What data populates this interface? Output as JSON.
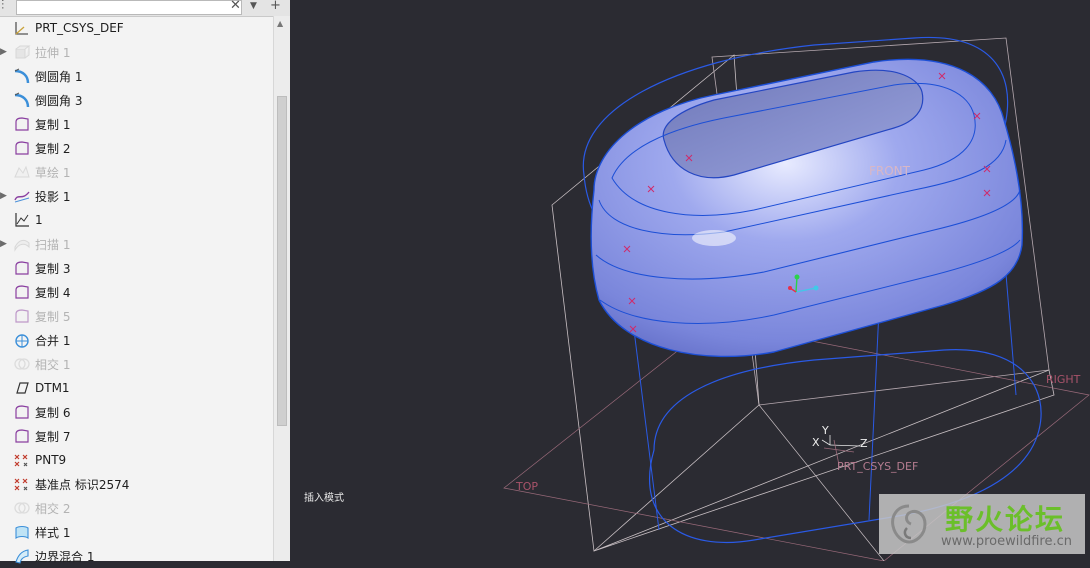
{
  "tree": {
    "items": [
      {
        "label": "PRT_CSYS_DEF",
        "icon": "csys-icon",
        "suppressed": false,
        "expandable": false
      },
      {
        "label": "拉伸 1",
        "icon": "extrude-icon",
        "suppressed": true,
        "expandable": true
      },
      {
        "label": "倒圆角 1",
        "icon": "round-icon",
        "suppressed": false,
        "expandable": false
      },
      {
        "label": "倒圆角 3",
        "icon": "round-icon",
        "suppressed": false,
        "expandable": false
      },
      {
        "label": "复制 1",
        "icon": "copy-surface-icon",
        "suppressed": false,
        "expandable": false
      },
      {
        "label": "复制 2",
        "icon": "copy-surface-icon",
        "suppressed": false,
        "expandable": false
      },
      {
        "label": "草绘 1",
        "icon": "sketch-icon",
        "suppressed": true,
        "expandable": false
      },
      {
        "label": "投影 1",
        "icon": "project-icon",
        "suppressed": false,
        "expandable": true
      },
      {
        "label": "1",
        "icon": "graph-icon",
        "suppressed": false,
        "expandable": false
      },
      {
        "label": "扫描 1",
        "icon": "sweep-icon",
        "suppressed": true,
        "expandable": true
      },
      {
        "label": "复制 3",
        "icon": "copy-surface-icon",
        "suppressed": false,
        "expandable": false
      },
      {
        "label": "复制 4",
        "icon": "copy-surface-icon",
        "suppressed": false,
        "expandable": false
      },
      {
        "label": "复制 5",
        "icon": "copy-surface-icon",
        "suppressed": true,
        "expandable": false
      },
      {
        "label": "合并 1",
        "icon": "merge-icon",
        "suppressed": false,
        "expandable": false
      },
      {
        "label": "相交 1",
        "icon": "intersect-icon",
        "suppressed": true,
        "expandable": false
      },
      {
        "label": "DTM1",
        "icon": "datum-plane-icon",
        "suppressed": false,
        "expandable": false
      },
      {
        "label": "复制 6",
        "icon": "copy-surface-icon",
        "suppressed": false,
        "expandable": false
      },
      {
        "label": "复制 7",
        "icon": "copy-surface-icon",
        "suppressed": false,
        "expandable": false
      },
      {
        "label": "PNT9",
        "icon": "datum-point-icon",
        "suppressed": false,
        "expandable": false
      },
      {
        "label": "基准点 标识2574",
        "icon": "datum-point-icon",
        "suppressed": false,
        "expandable": false
      },
      {
        "label": "相交 2",
        "icon": "intersect-icon",
        "suppressed": true,
        "expandable": false
      },
      {
        "label": "样式 1",
        "icon": "style-icon",
        "suppressed": false,
        "expandable": false
      },
      {
        "label": "边界混合 1",
        "icon": "boundary-blend-icon",
        "suppressed": false,
        "expandable": false
      }
    ]
  },
  "viewport": {
    "front_label": "FRONT",
    "top_label": "TOP",
    "right_label": "RIGHT",
    "csys_label": "PRT_CSYS_DEF",
    "axis_x": "X",
    "axis_y": "Y",
    "axis_z": "Z",
    "insert_mode": "插入模式"
  },
  "watermark": {
    "name": "野火论坛",
    "url": "www.proewildfire.cn"
  },
  "colors": {
    "background": "#2b2b32",
    "surface": "#8f9ae6",
    "edge": "#1c4fd6",
    "datum_plane": "#b0a0a8"
  }
}
